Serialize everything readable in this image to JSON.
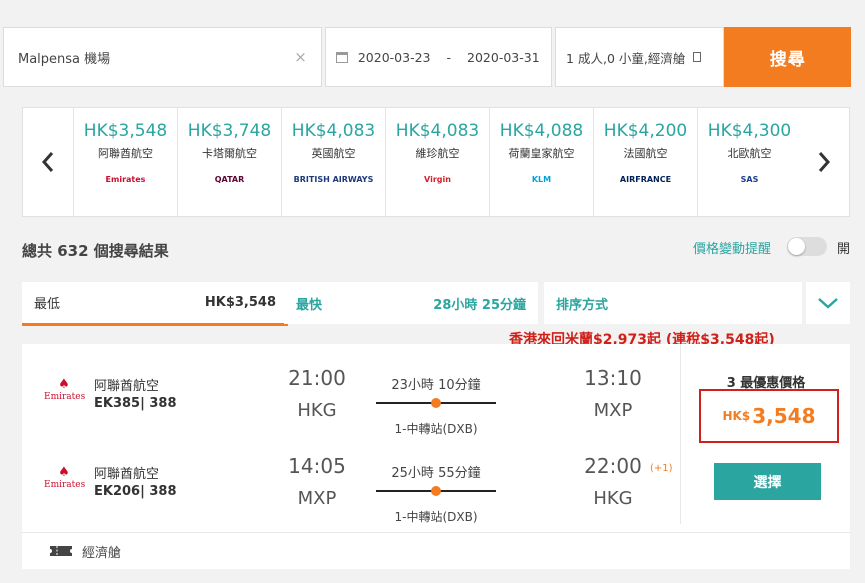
{
  "search": {
    "destination": "Malpensa 機場",
    "clear_glyph": "×",
    "depart_date": "2020-03-23",
    "date_sep": "-",
    "return_date": "2020-03-31",
    "passengers": "1 成人,0 小童,經濟艙",
    "search_label": "搜尋"
  },
  "carousel": {
    "items": [
      {
        "price": "HK$3,548",
        "airline": "阿聯酋航空",
        "logo_text": "Emirates",
        "logo_color": "#c8102e"
      },
      {
        "price": "HK$3,748",
        "airline": "卡塔爾航空",
        "logo_text": "QATAR",
        "logo_color": "#5c0632"
      },
      {
        "price": "HK$4,083",
        "airline": "英國航空",
        "logo_text": "BRITISH AIRWAYS",
        "logo_color": "#1f3a7a"
      },
      {
        "price": "HK$4,083",
        "airline": "維珍航空",
        "logo_text": "Virgin",
        "logo_color": "#d41f2d"
      },
      {
        "price": "HK$4,088",
        "airline": "荷蘭皇家航空",
        "logo_text": "KLM",
        "logo_color": "#00a1de"
      },
      {
        "price": "HK$4,200",
        "airline": "法國航空",
        "logo_text": "AIRFRANCE",
        "logo_color": "#002157"
      },
      {
        "price": "HK$4,300",
        "airline": "北歐航空",
        "logo_text": "SAS",
        "logo_color": "#1a3e8c"
      }
    ]
  },
  "results": {
    "total": "總共 632 個搜尋結果",
    "price_alert": "價格變動提醒",
    "toggle_label": "開"
  },
  "sort": {
    "cheapest_label": "最低",
    "cheapest_value": "HK$3,548",
    "fastest_label": "最快",
    "fastest_value": "28小時 25分鐘",
    "sort_label": "排序方式"
  },
  "promo": "香港來回米蘭$2,973起 (連稅$3,548起)",
  "flight": {
    "legs": [
      {
        "airline": "阿聯酋航空",
        "code": "EK385| 388",
        "logo_text": "Emirates",
        "dep_time": "21:00",
        "dep_port": "HKG",
        "duration": "23小時 10分鐘",
        "stops": "1-中轉站(DXB)",
        "arr_time": "13:10",
        "arr_port": "MXP",
        "plus_day": ""
      },
      {
        "airline": "阿聯酋航空",
        "code": "EK206| 388",
        "logo_text": "Emirates",
        "dep_time": "14:05",
        "dep_port": "MXP",
        "duration": "25小時 55分鐘",
        "stops": "1-中轉站(DXB)",
        "arr_time": "22:00",
        "arr_port": "HKG",
        "plus_day": "(+1)"
      }
    ],
    "deal_label": "3 最優惠價格",
    "price_currency": "HK$",
    "price_amount": "3,548",
    "select_label": "選擇",
    "cabin": "經濟艙"
  },
  "colors": {
    "accent_orange": "#f47c20",
    "teal": "#2aa5a0",
    "highlight_red": "#d0201a"
  }
}
